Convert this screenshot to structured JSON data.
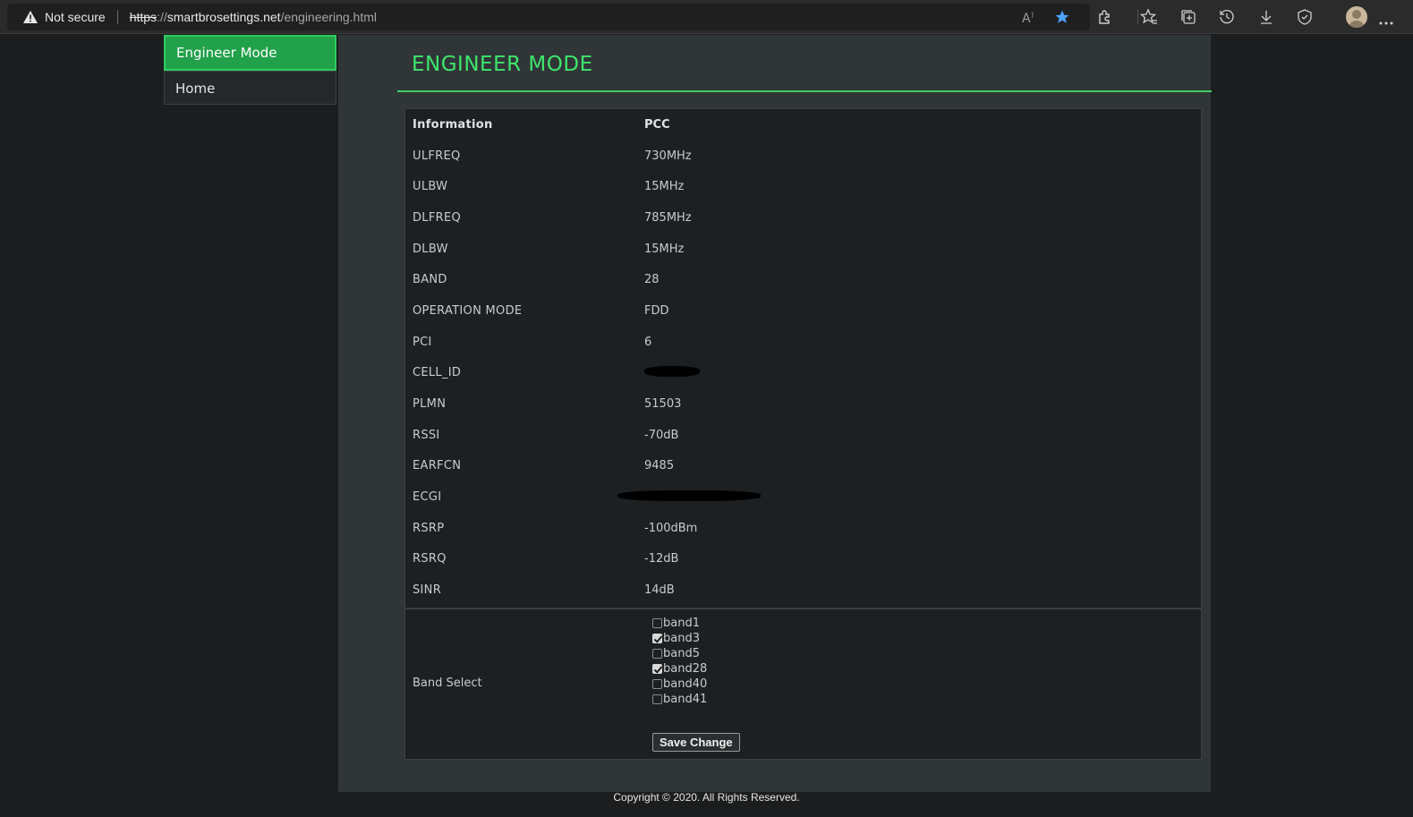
{
  "browser": {
    "security_label": "Not secure",
    "url_scheme": "https",
    "url_sep": "://",
    "url_host": "smartbrosettings.net",
    "url_path": "/engineering.html"
  },
  "sidebar": {
    "items": [
      {
        "label": "Engineer Mode",
        "active": true
      },
      {
        "label": "Home",
        "active": false
      }
    ]
  },
  "page": {
    "title": "ENGINEER MODE"
  },
  "table": {
    "header": {
      "key": "Information",
      "value": "PCC"
    },
    "rows": [
      {
        "key": "ULFREQ",
        "value": "730MHz"
      },
      {
        "key": "ULBW",
        "value": "15MHz"
      },
      {
        "key": "DLFREQ",
        "value": "785MHz"
      },
      {
        "key": "DLBW",
        "value": "15MHz"
      },
      {
        "key": "BAND",
        "value": "28"
      },
      {
        "key": "OPERATION MODE",
        "value": "FDD"
      },
      {
        "key": "PCI",
        "value": "6"
      },
      {
        "key": "CELL_ID",
        "value": ""
      },
      {
        "key": "PLMN",
        "value": "51503"
      },
      {
        "key": "RSSI",
        "value": "-70dB"
      },
      {
        "key": "EARFCN",
        "value": "9485"
      },
      {
        "key": "ECGI",
        "value": ""
      },
      {
        "key": "RSRP",
        "value": "-100dBm"
      },
      {
        "key": "RSRQ",
        "value": "-12dB"
      },
      {
        "key": "SINR",
        "value": "14dB"
      }
    ]
  },
  "band_select": {
    "label": "Band Select",
    "bands": [
      {
        "label": "band1",
        "checked": false
      },
      {
        "label": "band3",
        "checked": true
      },
      {
        "label": "band5",
        "checked": false
      },
      {
        "label": "band28",
        "checked": true
      },
      {
        "label": "band40",
        "checked": false
      },
      {
        "label": "band41",
        "checked": false
      }
    ],
    "save_label": "Save Change"
  },
  "footer": {
    "copyright": "Copyright © 2020. All Rights Reserved."
  },
  "colors": {
    "accent_green": "#3ee66b",
    "active_tab": "#21a14a",
    "star_blue": "#4da3ff"
  }
}
